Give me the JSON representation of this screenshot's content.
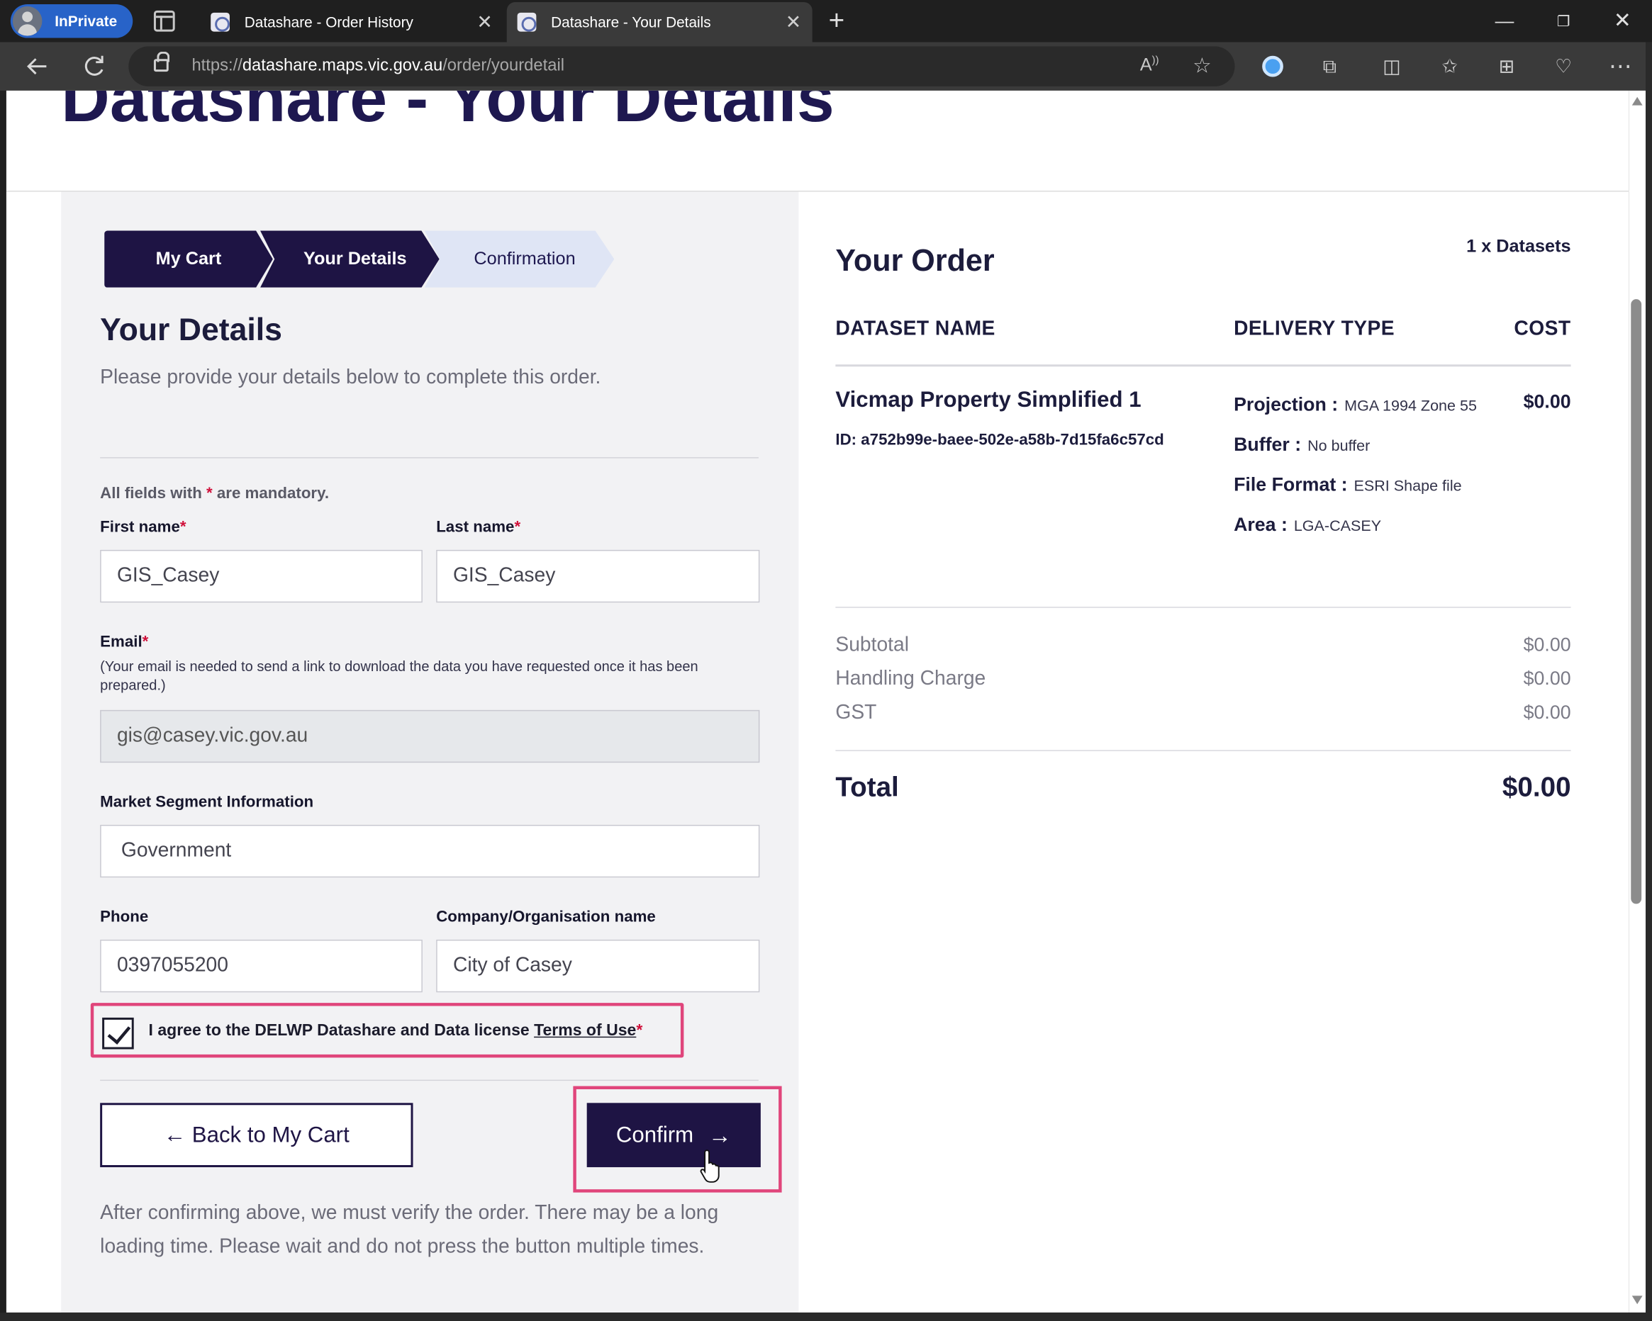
{
  "browser": {
    "inprivate_label": "InPrivate",
    "tabs": [
      {
        "title": "Datashare - Order History",
        "close": "✕"
      },
      {
        "title": "Datashare - Your Details",
        "close": "✕"
      }
    ],
    "new_tab": "+",
    "url_prefix": "https://",
    "url_domain": "datashare.maps.vic.gov.au",
    "url_path": "/order/yourdetail",
    "window_controls": {
      "minimize": "—",
      "maximize": "❐",
      "close": "✕"
    }
  },
  "page": {
    "heading_cut": "Datashare - Your Details",
    "breadcrumbs": [
      "My Cart",
      "Your Details",
      "Confirmation"
    ],
    "details_title": "Your Details",
    "intro": "Please provide your details below to complete this order.",
    "mandatory_prefix": "All fields with ",
    "mandatory_star": "*",
    "mandatory_suffix": " are mandatory.",
    "form": {
      "first_name_label": "First name",
      "first_name_value": "GIS_Casey",
      "last_name_label": "Last name",
      "last_name_value": "GIS_Casey",
      "email_label": "Email",
      "email_note": "(Your email is needed to send a link to download the data you have requested once it has been prepared.)",
      "email_value": "gis@casey.vic.gov.au",
      "market_label": "Market Segment Information",
      "market_value": "Government",
      "phone_label": "Phone",
      "phone_value": "0397055200",
      "company_label": "Company/Organisation name",
      "company_value": "City of Casey",
      "required_star": "*",
      "agree_text": "I agree to the DELWP Datashare and Data license ",
      "agree_link": "Terms of Use",
      "agree_checked": true
    },
    "buttons": {
      "back": "← Back to My Cart",
      "confirm": "Confirm",
      "confirm_arrow": "→"
    },
    "after_text": "After confirming above, we must verify the order. There may be a long loading time. Please wait and do not press the button multiple times."
  },
  "order": {
    "title": "Your Order",
    "dataset_count": "1 x Datasets",
    "columns": [
      "DATASET NAME",
      "DELIVERY TYPE",
      "COST"
    ],
    "item": {
      "name": "Vicmap Property Simplified 1",
      "id": "ID: a752b99e-baee-502e-a58b-7d15fa6c57cd",
      "delivery": [
        {
          "label": "Projection :",
          "value": "MGA 1994 Zone 55"
        },
        {
          "label": "Buffer :",
          "value": "No buffer"
        },
        {
          "label": "File Format :",
          "value": "ESRI Shape file"
        },
        {
          "label": "Area :",
          "value": "LGA-CASEY"
        }
      ],
      "cost": "$0.00"
    },
    "summary": [
      {
        "label": "Subtotal",
        "value": "$0.00"
      },
      {
        "label": "Handling Charge",
        "value": "$0.00"
      },
      {
        "label": "GST",
        "value": "$0.00"
      }
    ],
    "total_label": "Total",
    "total_value": "$0.00"
  },
  "colors": {
    "brand_navy": "#1e1444",
    "highlight_pink": "#e0457b",
    "required_red": "#d0103a",
    "inprivate_blue": "#2863c8"
  },
  "icons": [
    "profile-avatar-icon",
    "tab-actions-icon",
    "datashare-favicon",
    "close-tab-icon",
    "new-tab-icon",
    "back-arrow-icon",
    "reload-icon",
    "lock-icon",
    "read-aloud-icon",
    "favorite-star-icon",
    "password-manager-icon",
    "extensions-icon",
    "split-screen-icon",
    "favorites-icon",
    "collections-icon",
    "browser-essentials-icon",
    "more-menu-icon",
    "checkmark-icon",
    "hand-cursor-icon"
  ]
}
